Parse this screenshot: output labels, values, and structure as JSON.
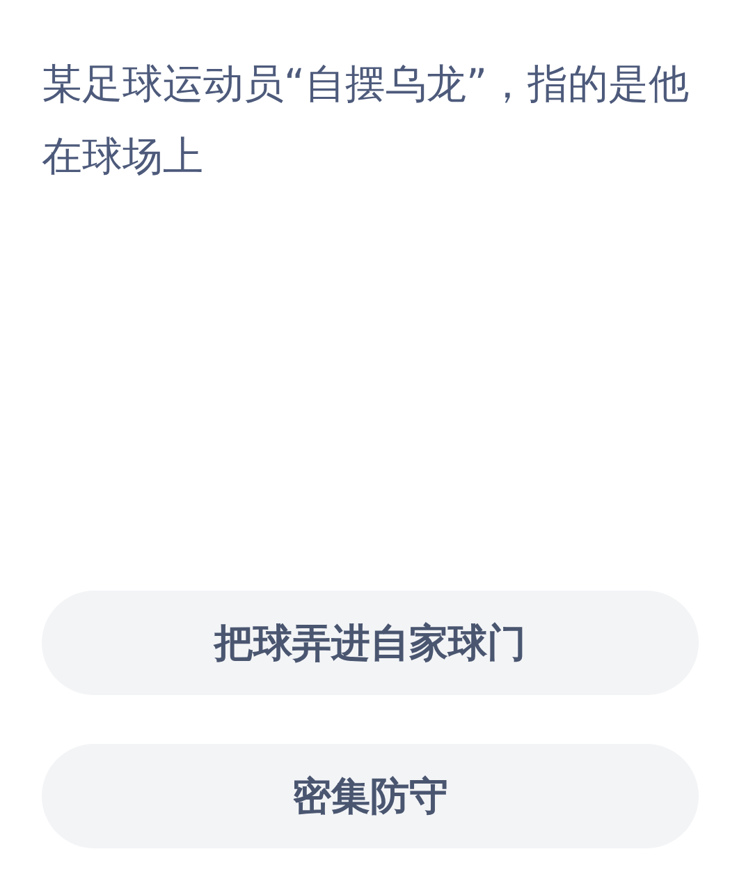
{
  "question": "某足球运动员“自摆乌龙”，指的是他在球场上",
  "options": [
    {
      "label": "把球弄进自家球门"
    },
    {
      "label": "密集防守"
    }
  ]
}
